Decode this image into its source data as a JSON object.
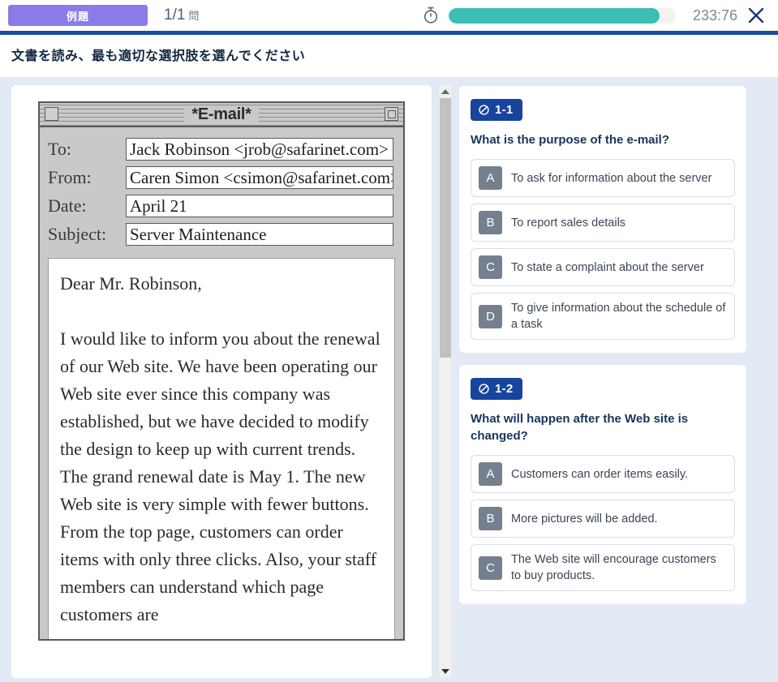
{
  "topbar": {
    "example_badge": "例題",
    "counter_number": "1/1",
    "counter_unit": "問",
    "timer_icon": "stopwatch-icon",
    "timer_value": "233:76",
    "timer_progress_percent": 93,
    "timer_fill_color": "#3cbeb4",
    "close_icon": "close-icon",
    "badge_color": "#8a7ce8",
    "underline_color": "#1a4d9e"
  },
  "instruction": {
    "text": "文書を読み、最も適切な選択肢を選んでください"
  },
  "document": {
    "window_title": "*E-mail*",
    "fields": [
      {
        "label": "To:",
        "value": "Jack Robinson <jrob@safarinet.com>"
      },
      {
        "label": "From:",
        "value": "Caren Simon <csimon@safarinet.com>"
      },
      {
        "label": "Date:",
        "value": "April 21"
      },
      {
        "label": "Subject:",
        "value": "Server Maintenance"
      }
    ],
    "body": {
      "greeting": "Dear Mr. Robinson,",
      "paragraph1": "I would like to inform you about the renewal of our Web site. We have been operating our Web site ever since this company was established, but we have decided to modify the design to keep up with current trends. The grand renewal date is May 1. The new Web site is very simple with fewer buttons. From the top page, customers can order items with only three clicks. Also, your staff members can understand which page customers are"
    }
  },
  "questions": [
    {
      "badge_icon": "circle-slash-icon",
      "badge_label": "1-1",
      "title": "What is the purpose of the e-mail?",
      "options": [
        {
          "key": "A",
          "text": "To ask for information about the server"
        },
        {
          "key": "B",
          "text": "To report sales details"
        },
        {
          "key": "C",
          "text": "To state a complaint about the server"
        },
        {
          "key": "D",
          "text": "To give information about the schedule of a task"
        }
      ]
    },
    {
      "badge_icon": "circle-slash-icon",
      "badge_label": "1-2",
      "title": "What will happen after the Web site is changed?",
      "options": [
        {
          "key": "A",
          "text": "Customers can order items easily."
        },
        {
          "key": "B",
          "text": "More pictures will be added."
        },
        {
          "key": "C",
          "text": "The Web site will encourage customers to buy products."
        }
      ]
    }
  ],
  "scrollbars": {
    "left": {
      "up_icon": "caret-up-icon",
      "down_icon": "caret-down-icon"
    },
    "right": {
      "up_icon": "caret-up-icon",
      "down_icon": "caret-down-icon"
    }
  }
}
